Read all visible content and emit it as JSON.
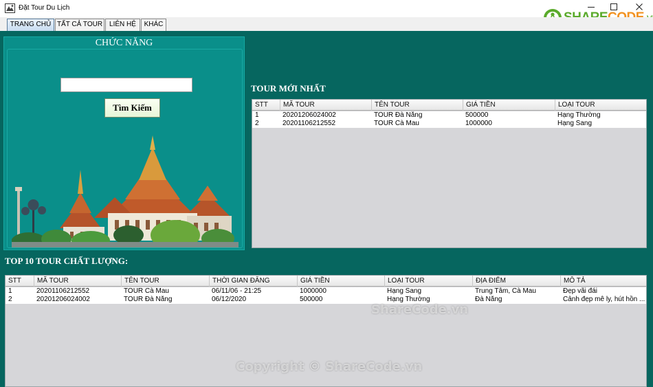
{
  "window": {
    "title": "Đặt Tour Du Lịch",
    "min_icon": "minimize-icon",
    "max_icon": "maximize-icon",
    "close_icon": "close-icon"
  },
  "logo": {
    "share": "SHARE",
    "code": "CODE",
    "vn": ".vn",
    "icon": "sharecode-logo-icon"
  },
  "tabs": [
    {
      "label": "TRANG CHỦ",
      "active": true
    },
    {
      "label": "TẤT CẢ TOUR",
      "active": false
    },
    {
      "label": "LIÊN HỆ",
      "active": false
    },
    {
      "label": "KHÁC",
      "active": false
    }
  ],
  "function_panel": {
    "title": "CHỨC NĂNG",
    "search_value": "",
    "search_button": "Tìm Kiếm",
    "image": "thai-temple-picture"
  },
  "newest_tours": {
    "heading": "TOUR MỚI NHẤT",
    "columns": [
      "STT",
      "MÃ TOUR",
      "TÊN TOUR",
      "GIÁ TIỀN",
      "LOẠI TOUR"
    ],
    "rows": [
      [
        "1",
        "20201206024002",
        "TOUR Đà Nẵng",
        "500000",
        "Hạng Thường"
      ],
      [
        "2",
        "20201106212552",
        "TOUR Cà Mau",
        "1000000",
        "Hạng Sang"
      ]
    ]
  },
  "top_tours": {
    "heading": "TOP 10 TOUR CHẤT LƯỢNG:",
    "columns": [
      "STT",
      "MÃ TOUR",
      "TÊN TOUR",
      "THỜI GIAN ĐĂNG",
      "GIÁ TIỀN",
      "LOẠI TOUR",
      "ĐỊA ĐIỂM",
      "MÔ TẢ"
    ],
    "rows": [
      [
        "1",
        "20201106212552",
        "TOUR Cà Mau",
        "06/11/06 - 21:25",
        "1000000",
        "Hạng Sang",
        "Trung Tâm, Cà Mau",
        "Đẹp vãi đái"
      ],
      [
        "2",
        "20201206024002",
        "TOUR Đà Nẵng",
        "06/12/2020",
        "500000",
        "Hạng Thường",
        "Đà Nẵng",
        "Cảnh đẹp mê ly, hút hồn ..."
      ]
    ]
  },
  "watermarks": {
    "sharecode": "ShareCode.vn",
    "copyright": "Copyright © ShareCode.vn"
  },
  "colors": {
    "background": "#06665f",
    "panel": "#0a8f8a",
    "table_bg": "#d6d6d9",
    "logo_green": "#5aaa2b",
    "logo_orange": "#f29221"
  }
}
